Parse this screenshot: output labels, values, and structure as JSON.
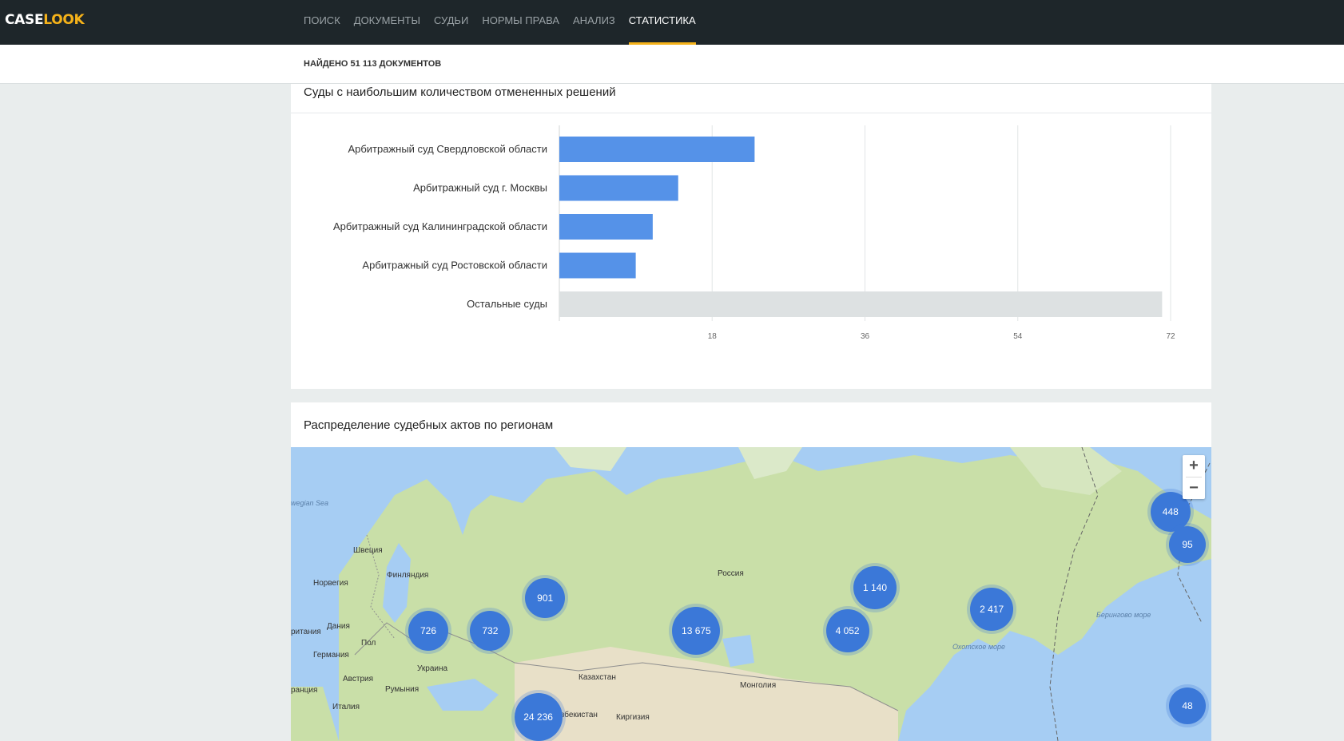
{
  "logo": {
    "part1": "CASE",
    "part2": "LOOK"
  },
  "nav": {
    "items": [
      "ПОИСК",
      "ДОКУМЕНТЫ",
      "СУДЬИ",
      "НОРМЫ ПРАВА",
      "АНАЛИЗ",
      "СТАТИСТИКА"
    ],
    "active": "СТАТИСТИКА"
  },
  "results": {
    "found_text": "НАЙДЕНО 51 113 ДОКУМЕНТОВ"
  },
  "panels": {
    "chart_title": "Суды с наибольшим количеством отмененных решений",
    "map_title": "Распределение судебных актов по регионам"
  },
  "chart_data": {
    "type": "bar",
    "orientation": "horizontal",
    "categories": [
      "Арбитражный суд Свердловской области",
      "Арбитражный суд г. Москвы",
      "Арбитражный суд Калининградской области",
      "Арбитражный суд Ростовской области",
      "Остальные суды"
    ],
    "values": [
      23,
      14,
      11,
      9,
      71
    ],
    "bar_colors": [
      "#5592e8",
      "#5592e8",
      "#5592e8",
      "#5592e8",
      "#dde1e2"
    ],
    "xticks": [
      18,
      36,
      54,
      72
    ],
    "xlim": [
      0,
      72
    ],
    "grid": true
  },
  "map": {
    "zoom_in": "+",
    "zoom_out": "−",
    "clusters": [
      {
        "label": "448",
        "lon": 130,
        "lat": 66
      },
      {
        "label": "95",
        "lon": 159,
        "lat": 63
      },
      {
        "label": "901",
        "lon": 39,
        "lat": 58
      },
      {
        "label": "1 140",
        "lon": 87,
        "lat": 59
      },
      {
        "label": "2 417",
        "lon": 104,
        "lat": 57
      },
      {
        "label": "726",
        "lon": 22,
        "lat": 55
      },
      {
        "label": "732",
        "lon": 31,
        "lat": 55
      },
      {
        "label": "13 675",
        "lon": 61,
        "lat": 55
      },
      {
        "label": "4 052",
        "lon": 83,
        "lat": 55
      },
      {
        "label": "48",
        "lon": 135,
        "lat": 48
      },
      {
        "label": "24 236",
        "lon": 38,
        "lat": 47
      }
    ],
    "labels": [
      {
        "text": "wegian Sea",
        "kind": "sea"
      },
      {
        "text": "Швеция",
        "kind": "country"
      },
      {
        "text": "Финляндия",
        "kind": "country"
      },
      {
        "text": "Норвегия",
        "kind": "country"
      },
      {
        "text": "Россия",
        "kind": "country"
      },
      {
        "text": "Дания",
        "kind": "country"
      },
      {
        "text": "ритания",
        "kind": "country"
      },
      {
        "text": "Пол",
        "kind": "country"
      },
      {
        "text": "Германия",
        "kind": "country"
      },
      {
        "text": "Украина",
        "kind": "country"
      },
      {
        "text": "Австрия",
        "kind": "country"
      },
      {
        "text": "Румыния",
        "kind": "country"
      },
      {
        "text": "ранция",
        "kind": "country"
      },
      {
        "text": "Италия",
        "kind": "country"
      },
      {
        "text": "Казахстан",
        "kind": "country"
      },
      {
        "text": "Монголия",
        "kind": "country"
      },
      {
        "text": "Узбекистан",
        "kind": "country"
      },
      {
        "text": "Киргизия",
        "kind": "country"
      },
      {
        "text": "Охотское море",
        "kind": "sea"
      },
      {
        "text": "Берингово море",
        "kind": "sea"
      }
    ]
  }
}
